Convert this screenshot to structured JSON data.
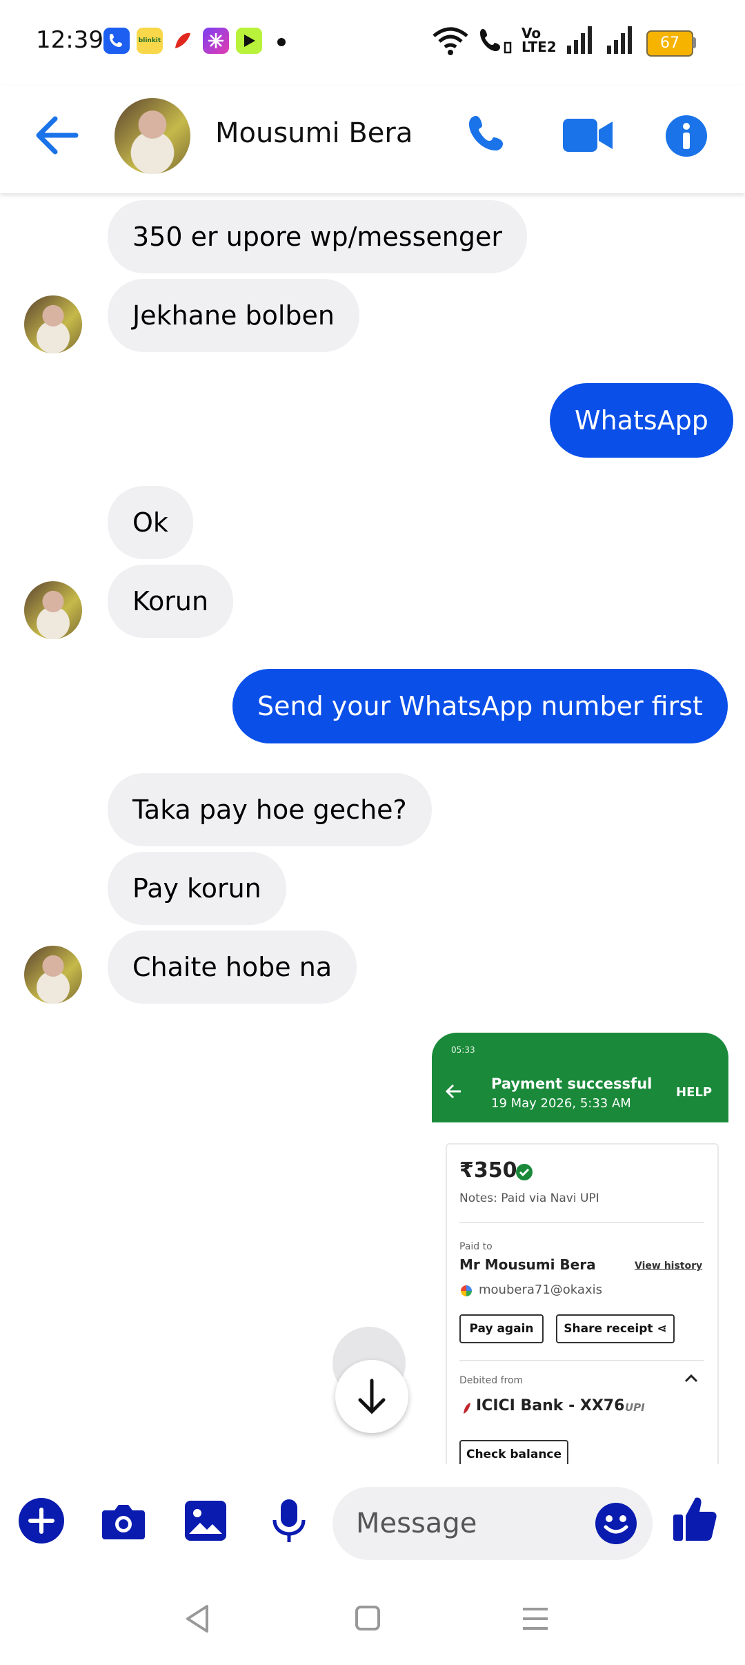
{
  "status_bar": {
    "time": "12:39",
    "battery": "67",
    "network_label_top": "Vo",
    "network_label_bottom": "LTE2",
    "app_icons": [
      "phone-app-icon",
      "blinkit-icon",
      "airtel-icon",
      "perplexity-icon",
      "game-icon"
    ],
    "blinkit_label": "blinkit"
  },
  "header": {
    "contact_name": "Mousumi Bera"
  },
  "messages": [
    {
      "dir": "in",
      "text": "350 er upore wp/messenger"
    },
    {
      "dir": "in",
      "text": "Jekhane bolben"
    },
    {
      "dir": "out",
      "text": "WhatsApp"
    },
    {
      "dir": "in",
      "text": "Ok"
    },
    {
      "dir": "in",
      "text": "Korun"
    },
    {
      "dir": "out",
      "text": "Send your WhatsApp number first"
    },
    {
      "dir": "in",
      "text": "Taka pay hoe geche?"
    },
    {
      "dir": "in",
      "text": "Pay korun"
    },
    {
      "dir": "in",
      "text": "Chaite hobe na"
    }
  ],
  "payment_screenshot": {
    "time": "05:33",
    "title": "Payment successful",
    "date": "19 May 2026, 5:33 AM",
    "help": "HELP",
    "amount": "₹350",
    "notes": "Notes: Paid via Navi UPI",
    "paid_to_label": "Paid to",
    "payee": "Mr Mousumi Bera",
    "view_history": "View history",
    "upi_id": "moubera71@okaxis",
    "pay_again": "Pay again",
    "share_receipt": "Share receipt",
    "debited_from_label": "Debited from",
    "bank": "ICICI Bank - XX76",
    "upi_logo": "UPI",
    "check_balance": "Check balance"
  },
  "composer": {
    "placeholder": "Message"
  },
  "colors": {
    "accent": "#0a4fe8",
    "header_icon": "#1a73e8",
    "composer_icon": "#0a1bb0",
    "incoming_bubble": "#f0f0f2",
    "payment_green": "#1a8a3a"
  }
}
